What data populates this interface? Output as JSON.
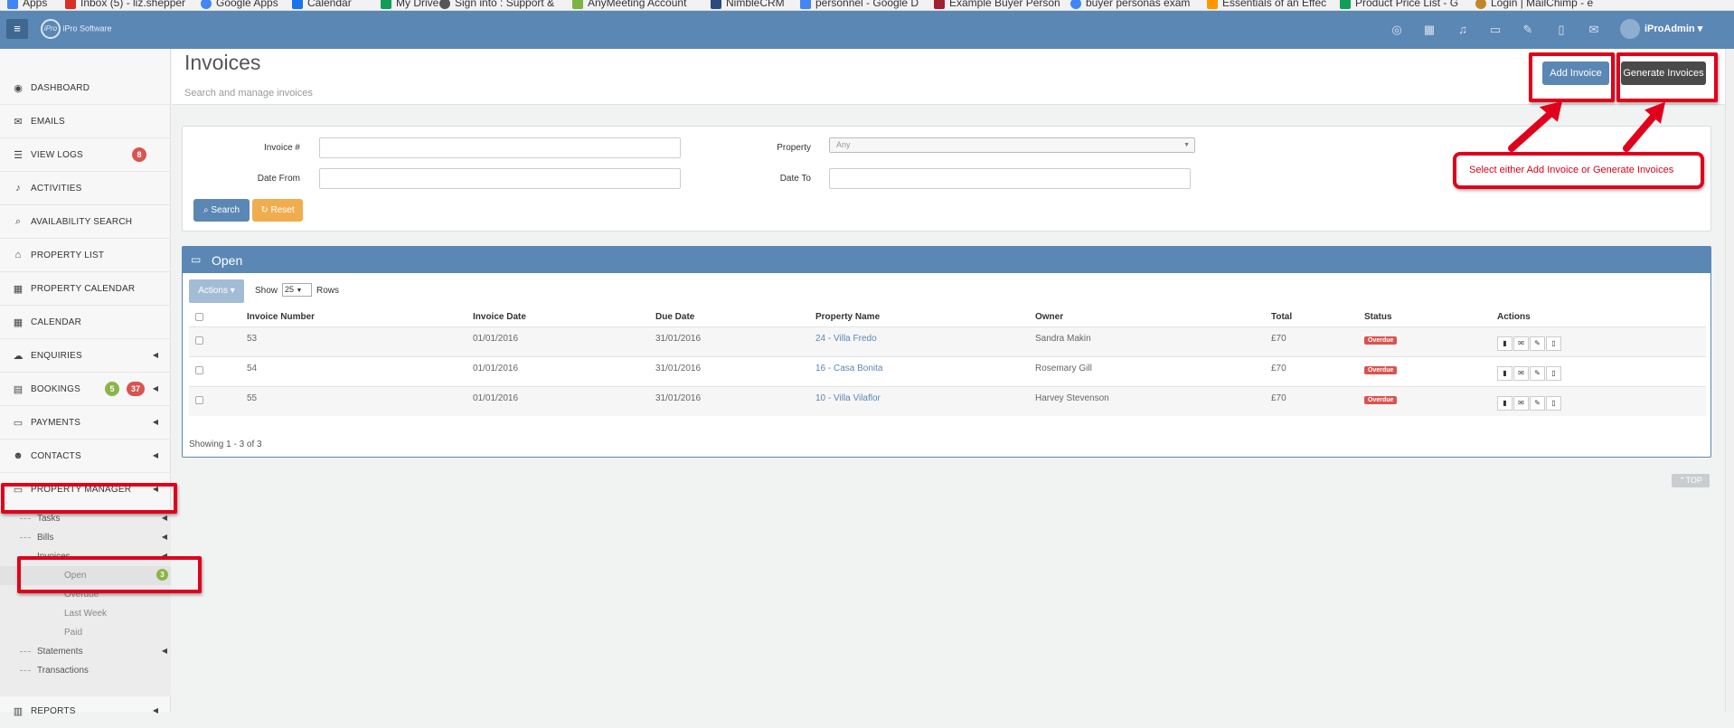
{
  "bookmarks": [
    "Apps",
    "Inbox (5) - liz.shepper",
    "Google Apps",
    "Calendar",
    "My Drive",
    "Sign into : Support &",
    "AnyMeeting Account",
    "NimbleCRM",
    "personnel - Google D",
    "Example Buyer Person",
    "buyer personas exam",
    "Essentials of an Effec",
    "Product Price List - G",
    "Login | MailChimp - e"
  ],
  "topbar": {
    "logo_text": "iPro Software",
    "menu_glyph": "≡",
    "user": "iProAdmin",
    "user_caret": "▾"
  },
  "sidebar": {
    "items": [
      {
        "label": "DASHBOARD",
        "icon": "dashboard-icon",
        "glyph": "◉"
      },
      {
        "label": "EMAILS",
        "icon": "envelope-icon",
        "glyph": "✉"
      },
      {
        "label": "VIEW LOGS",
        "icon": "list-icon",
        "glyph": "☰",
        "badge": "8"
      },
      {
        "label": "ACTIVITIES",
        "icon": "bell-icon",
        "glyph": "♪"
      },
      {
        "label": "AVAILABILITY SEARCH",
        "icon": "search-icon",
        "glyph": "⌕"
      },
      {
        "label": "PROPERTY LIST",
        "icon": "home-icon",
        "glyph": "⌂"
      },
      {
        "label": "PROPERTY CALENDAR",
        "icon": "calendar-icon",
        "glyph": "▦"
      },
      {
        "label": "CALENDAR",
        "icon": "calendar-icon",
        "glyph": "▦"
      },
      {
        "label": "ENQUIRIES",
        "icon": "comments-icon",
        "glyph": "☁",
        "caret": "◀"
      },
      {
        "label": "BOOKINGS",
        "icon": "book-icon",
        "glyph": "▤",
        "badge_green": "5",
        "badge": "37",
        "caret": "◀"
      },
      {
        "label": "PAYMENTS",
        "icon": "payments-icon",
        "glyph": "▭",
        "caret": "◀"
      },
      {
        "label": "CONTACTS",
        "icon": "user-icon",
        "glyph": "☻",
        "caret": "◀"
      },
      {
        "label": "PROPERTY MANAGER",
        "icon": "monitor-icon",
        "glyph": "▭",
        "caret": "◀"
      }
    ],
    "sub_items": [
      {
        "label": "Tasks",
        "caret": "◀"
      },
      {
        "label": "Bills",
        "caret": "◀"
      },
      {
        "label": "Invoices",
        "caret": "◀"
      }
    ],
    "invoice_items": [
      {
        "label": "Open",
        "badge": "3"
      },
      {
        "label": "Overdue"
      },
      {
        "label": "Last Week"
      },
      {
        "label": "Paid"
      }
    ],
    "tail_items": [
      {
        "label": "Statements",
        "caret": "◀"
      },
      {
        "label": "Transactions"
      }
    ],
    "reports": {
      "label": "REPORTS",
      "glyph": "▥",
      "caret": "◀"
    }
  },
  "header": {
    "title": "Invoices",
    "subtitle": "Search and manage invoices",
    "add_label": "Add Invoice",
    "generate_label": "Generate Invoices"
  },
  "callout": "Select either Add Invoice or Generate Invoices",
  "filters": {
    "invoice_no_label": "Invoice #",
    "invoice_no_value": "",
    "date_from_label": "Date From",
    "date_from_value": "",
    "property_label": "Property",
    "property_value": "Any",
    "date_to_label": "Date To",
    "date_to_value": "",
    "search_label": "Search",
    "reset_label": "Reset"
  },
  "open_panel": {
    "title": "Open",
    "actions_label": "Actions",
    "show_label": "Show",
    "rows_value": "25",
    "rows_label": "Rows",
    "columns": [
      "Invoice Number",
      "Invoice Date",
      "Due Date",
      "Property Name",
      "Owner",
      "Total",
      "Status",
      "Actions"
    ],
    "rows": [
      {
        "number": "53",
        "date": "01/01/2016",
        "due": "31/01/2016",
        "property": "24 - Villa Fredo",
        "owner": "Sandra Makin",
        "total": "£70",
        "status": "Overdue"
      },
      {
        "number": "54",
        "date": "01/01/2016",
        "due": "31/01/2016",
        "property": "16 - Casa Bonita",
        "owner": "Rosemary Gill",
        "total": "£70",
        "status": "Overdue"
      },
      {
        "number": "55",
        "date": "01/01/2016",
        "due": "31/01/2016",
        "property": "10 - Villa Vilaflor",
        "owner": "Harvey Stevenson",
        "total": "£70",
        "status": "Overdue"
      }
    ],
    "showing": "Showing 1 - 3 of 3"
  },
  "top_label": "TOP",
  "colors": {
    "brand": "#5b87b4",
    "annotation_red": "#e0001b",
    "overdue": "#d9534f",
    "reset": "#f0ad4e",
    "badge_green": "#8cb449"
  }
}
